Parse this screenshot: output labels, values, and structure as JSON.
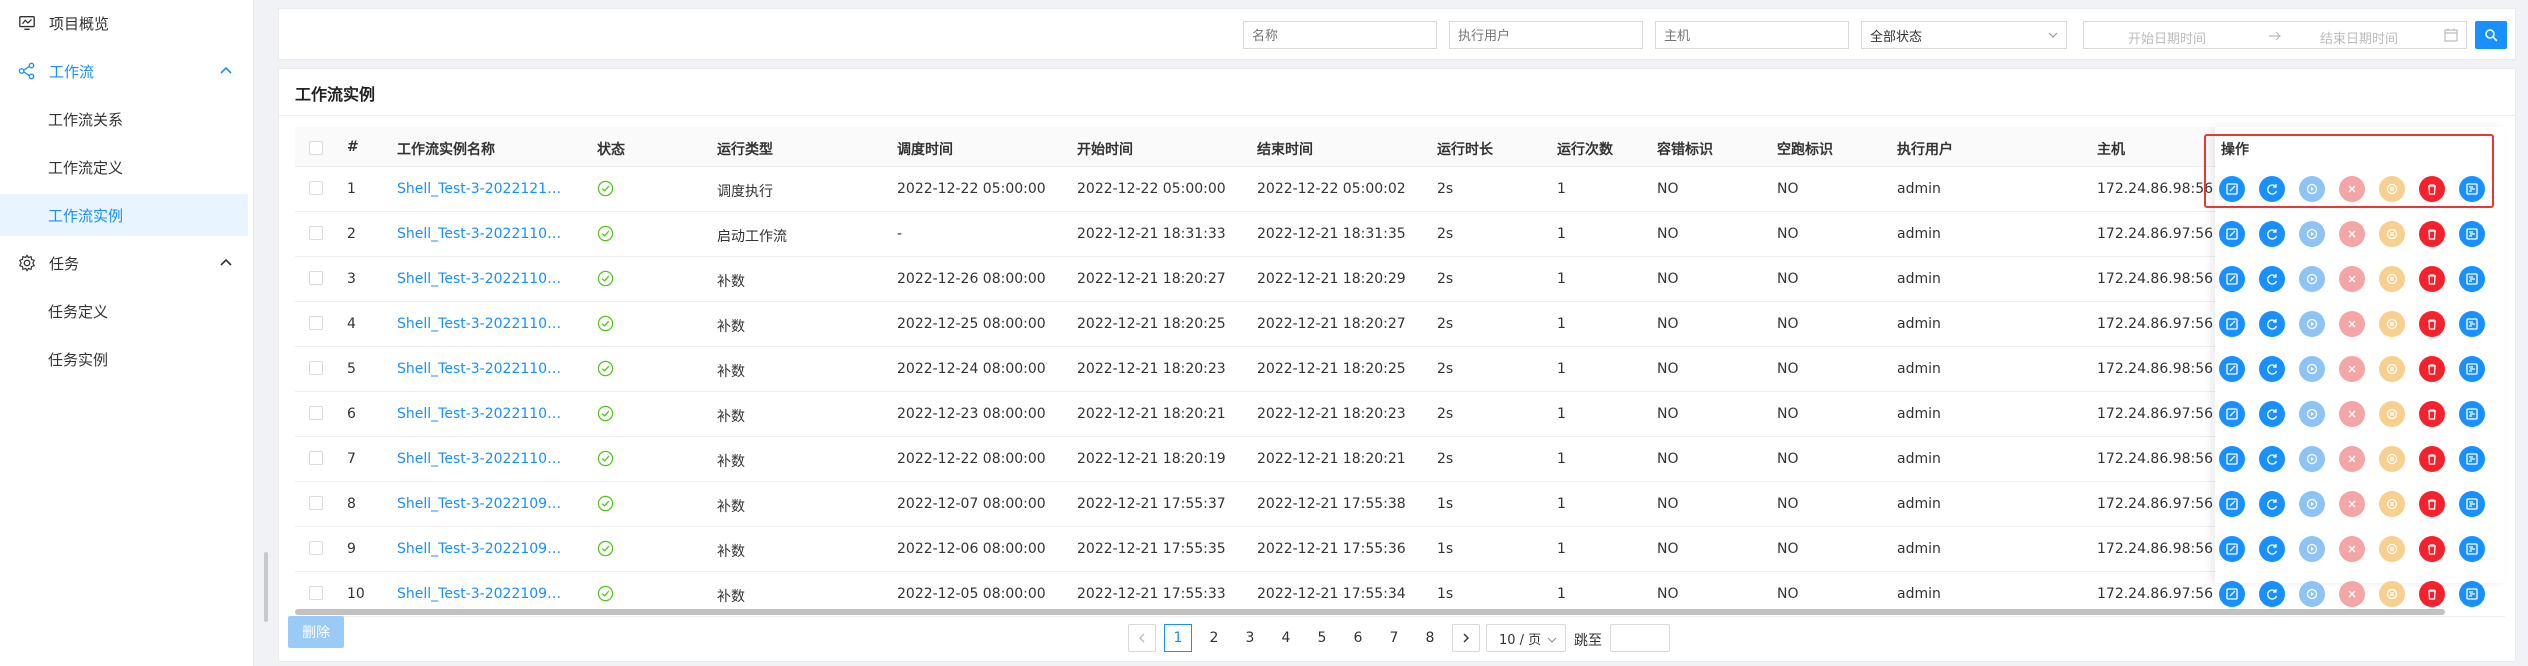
{
  "sidebar": {
    "items": [
      {
        "label": "项目概览"
      },
      {
        "label": "工作流"
      },
      {
        "label": "工作流关系"
      },
      {
        "label": "工作流定义"
      },
      {
        "label": "工作流实例"
      },
      {
        "label": "任务"
      },
      {
        "label": "任务定义"
      },
      {
        "label": "任务实例"
      }
    ]
  },
  "filters": {
    "name_placeholder": "名称",
    "user_placeholder": "执行用户",
    "host_placeholder": "主机",
    "state_value": "全部状态",
    "start_placeholder": "开始日期时间",
    "end_placeholder": "结束日期时间"
  },
  "card": {
    "title": "工作流实例"
  },
  "table": {
    "headers": [
      "#",
      "工作流实例名称",
      "状态",
      "运行类型",
      "调度时间",
      "开始时间",
      "结束时间",
      "运行时长",
      "运行次数",
      "容错标识",
      "空跑标识",
      "执行用户",
      "主机",
      "操作"
    ],
    "rows": [
      {
        "no": "1",
        "name": "Shell_Test-3-2022121…",
        "type": "调度执行",
        "sched": "2022-12-22 05:00:00",
        "start": "2022-12-22 05:00:00",
        "end": "2022-12-22 05:00:02",
        "dur": "2s",
        "runs": "1",
        "ft": "NO",
        "dry": "NO",
        "user": "admin",
        "host": "172.24.86.98:56"
      },
      {
        "no": "2",
        "name": "Shell_Test-3-2022110…",
        "type": "启动工作流",
        "sched": "-",
        "start": "2022-12-21 18:31:33",
        "end": "2022-12-21 18:31:35",
        "dur": "2s",
        "runs": "1",
        "ft": "NO",
        "dry": "NO",
        "user": "admin",
        "host": "172.24.86.97:56"
      },
      {
        "no": "3",
        "name": "Shell_Test-3-2022110…",
        "type": "补数",
        "sched": "2022-12-26 08:00:00",
        "start": "2022-12-21 18:20:27",
        "end": "2022-12-21 18:20:29",
        "dur": "2s",
        "runs": "1",
        "ft": "NO",
        "dry": "NO",
        "user": "admin",
        "host": "172.24.86.98:56"
      },
      {
        "no": "4",
        "name": "Shell_Test-3-2022110…",
        "type": "补数",
        "sched": "2022-12-25 08:00:00",
        "start": "2022-12-21 18:20:25",
        "end": "2022-12-21 18:20:27",
        "dur": "2s",
        "runs": "1",
        "ft": "NO",
        "dry": "NO",
        "user": "admin",
        "host": "172.24.86.97:56"
      },
      {
        "no": "5",
        "name": "Shell_Test-3-2022110…",
        "type": "补数",
        "sched": "2022-12-24 08:00:00",
        "start": "2022-12-21 18:20:23",
        "end": "2022-12-21 18:20:25",
        "dur": "2s",
        "runs": "1",
        "ft": "NO",
        "dry": "NO",
        "user": "admin",
        "host": "172.24.86.98:56"
      },
      {
        "no": "6",
        "name": "Shell_Test-3-2022110…",
        "type": "补数",
        "sched": "2022-12-23 08:00:00",
        "start": "2022-12-21 18:20:21",
        "end": "2022-12-21 18:20:23",
        "dur": "2s",
        "runs": "1",
        "ft": "NO",
        "dry": "NO",
        "user": "admin",
        "host": "172.24.86.97:56"
      },
      {
        "no": "7",
        "name": "Shell_Test-3-2022110…",
        "type": "补数",
        "sched": "2022-12-22 08:00:00",
        "start": "2022-12-21 18:20:19",
        "end": "2022-12-21 18:20:21",
        "dur": "2s",
        "runs": "1",
        "ft": "NO",
        "dry": "NO",
        "user": "admin",
        "host": "172.24.86.98:56"
      },
      {
        "no": "8",
        "name": "Shell_Test-3-2022109…",
        "type": "补数",
        "sched": "2022-12-07 08:00:00",
        "start": "2022-12-21 17:55:37",
        "end": "2022-12-21 17:55:38",
        "dur": "1s",
        "runs": "1",
        "ft": "NO",
        "dry": "NO",
        "user": "admin",
        "host": "172.24.86.97:56"
      },
      {
        "no": "9",
        "name": "Shell_Test-3-2022109…",
        "type": "补数",
        "sched": "2022-12-06 08:00:00",
        "start": "2022-12-21 17:55:35",
        "end": "2022-12-21 17:55:36",
        "dur": "1s",
        "runs": "1",
        "ft": "NO",
        "dry": "NO",
        "user": "admin",
        "host": "172.24.86.98:56"
      },
      {
        "no": "10",
        "name": "Shell_Test-3-2022109…",
        "type": "补数",
        "sched": "2022-12-05 08:00:00",
        "start": "2022-12-21 17:55:33",
        "end": "2022-12-21 17:55:34",
        "dur": "1s",
        "runs": "1",
        "ft": "NO",
        "dry": "NO",
        "user": "admin",
        "host": "172.24.86.97:56"
      }
    ],
    "status_color": "#52c41a",
    "link_color": "#1890ff"
  },
  "actions": [
    {
      "icon": "edit-icon",
      "color": "#1890ff"
    },
    {
      "icon": "rerun-icon",
      "color": "#1890ff"
    },
    {
      "icon": "recover-icon",
      "color": "#8ec4f5"
    },
    {
      "icon": "stop-icon",
      "color": "#f4a5a5"
    },
    {
      "icon": "pause-icon",
      "color": "#f7cf8f"
    },
    {
      "icon": "delete-icon",
      "color": "#f5222d"
    },
    {
      "icon": "gantt-icon",
      "color": "#1890ff"
    }
  ],
  "footer": {
    "delete_label": "删除",
    "pages": [
      "1",
      "2",
      "3",
      "4",
      "5",
      "6",
      "7",
      "8"
    ],
    "current_page": "1",
    "page_size": "10 / 页",
    "jump_label": "跳至"
  }
}
